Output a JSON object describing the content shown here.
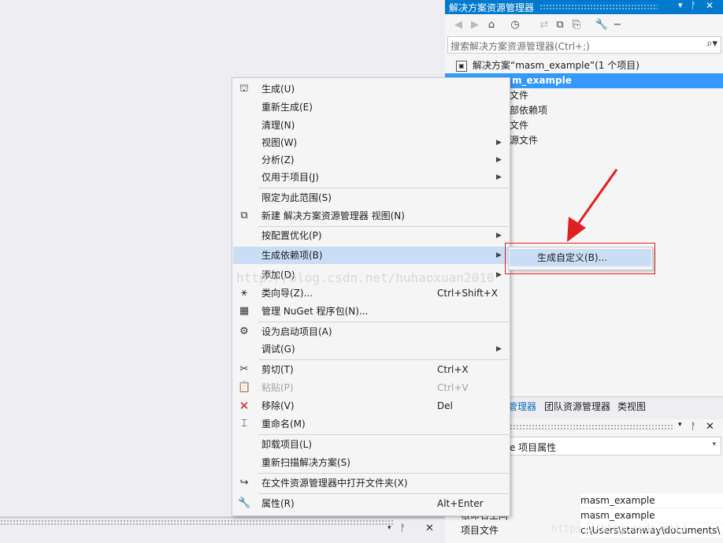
{
  "solution_explorer": {
    "title": "解决方案资源管理器",
    "search_placeholder": "搜索解决方案资源管理器(Ctrl+;)",
    "tree": [
      {
        "label": "解决方案“masm_example”(1 个项目)",
        "selected": false
      },
      {
        "label": "m_example",
        "selected": true
      },
      {
        "label": "文件",
        "selected": false
      },
      {
        "label": "部依赖项",
        "selected": false
      },
      {
        "label": "文件",
        "selected": false
      },
      {
        "label": "源文件",
        "selected": false
      }
    ],
    "tabs": [
      "管理器",
      "团队资源管理器",
      "类视图"
    ]
  },
  "properties": {
    "object": "ple  项目属性",
    "rows": [
      {
        "key": "",
        "value": "masm_example"
      },
      {
        "key": "根命名空间",
        "value": "masm_example"
      },
      {
        "key": "项目文件",
        "value": "c:\\Users\\stanway\\documents\\"
      }
    ]
  },
  "context_menu": {
    "items": [
      {
        "label": "生成(U)",
        "icon": "build-icon",
        "shortcut": "",
        "submenu": false
      },
      {
        "label": "重新生成(E)",
        "icon": "",
        "shortcut": "",
        "submenu": false
      },
      {
        "label": "清理(N)",
        "icon": "",
        "shortcut": "",
        "submenu": false
      },
      {
        "label": "视图(W)",
        "icon": "",
        "shortcut": "",
        "submenu": true
      },
      {
        "label": "分析(Z)",
        "icon": "",
        "shortcut": "",
        "submenu": true
      },
      {
        "label": "仅用于项目(J)",
        "icon": "",
        "shortcut": "",
        "submenu": true
      },
      {
        "label": "限定为此范围(S)",
        "icon": "",
        "shortcut": "",
        "submenu": false
      },
      {
        "label": "新建 解决方案资源管理器 视图(N)",
        "icon": "new-view-icon",
        "shortcut": "",
        "submenu": false
      },
      {
        "label": "按配置优化(P)",
        "icon": "",
        "shortcut": "",
        "submenu": true
      },
      {
        "label": "生成依赖项(B)",
        "icon": "",
        "shortcut": "",
        "submenu": true
      },
      {
        "label": "添加(D)",
        "icon": "",
        "shortcut": "",
        "submenu": true
      },
      {
        "label": "类向导(Z)...",
        "icon": "class-wizard-icon",
        "shortcut": "Ctrl+Shift+X",
        "submenu": false
      },
      {
        "label": "管理 NuGet 程序包(N)...",
        "icon": "nuget-icon",
        "shortcut": "",
        "submenu": false
      },
      {
        "label": "设为启动项目(A)",
        "icon": "gear-icon",
        "shortcut": "",
        "submenu": false
      },
      {
        "label": "调试(G)",
        "icon": "",
        "shortcut": "",
        "submenu": true
      },
      {
        "label": "剪切(T)",
        "icon": "scissors-icon",
        "shortcut": "Ctrl+X",
        "submenu": false
      },
      {
        "label": "粘贴(P)",
        "icon": "paste-icon",
        "shortcut": "Ctrl+V",
        "submenu": false
      },
      {
        "label": "移除(V)",
        "icon": "remove-x-icon",
        "shortcut": "Del",
        "submenu": false
      },
      {
        "label": "重命名(M)",
        "icon": "rename-icon",
        "shortcut": "",
        "submenu": false
      },
      {
        "label": "卸载项目(L)",
        "icon": "",
        "shortcut": "",
        "submenu": false
      },
      {
        "label": "重新扫描解决方案(S)",
        "icon": "",
        "shortcut": "",
        "submenu": false
      },
      {
        "label": "在文件资源管理器中打开文件夹(X)",
        "icon": "open-folder-arrow-icon",
        "shortcut": "",
        "submenu": false
      },
      {
        "label": "属性(R)",
        "icon": "wrench-icon",
        "shortcut": "Alt+Enter",
        "submenu": false
      }
    ],
    "highlighted": "生成依赖项(B)",
    "disabled": [
      "粘贴(P)"
    ]
  },
  "submenu": {
    "items": [
      {
        "label": "生成自定义(B)..."
      }
    ]
  },
  "watermarks": [
    "http://blog.csdn.net/huhaoxuan2010",
    "https://blog.csdn.net/..."
  ],
  "colors": {
    "title_bar": "#007acc",
    "selection": "#3399ff",
    "menu_highlight": "#c9def5",
    "annotation": "#e02020"
  }
}
